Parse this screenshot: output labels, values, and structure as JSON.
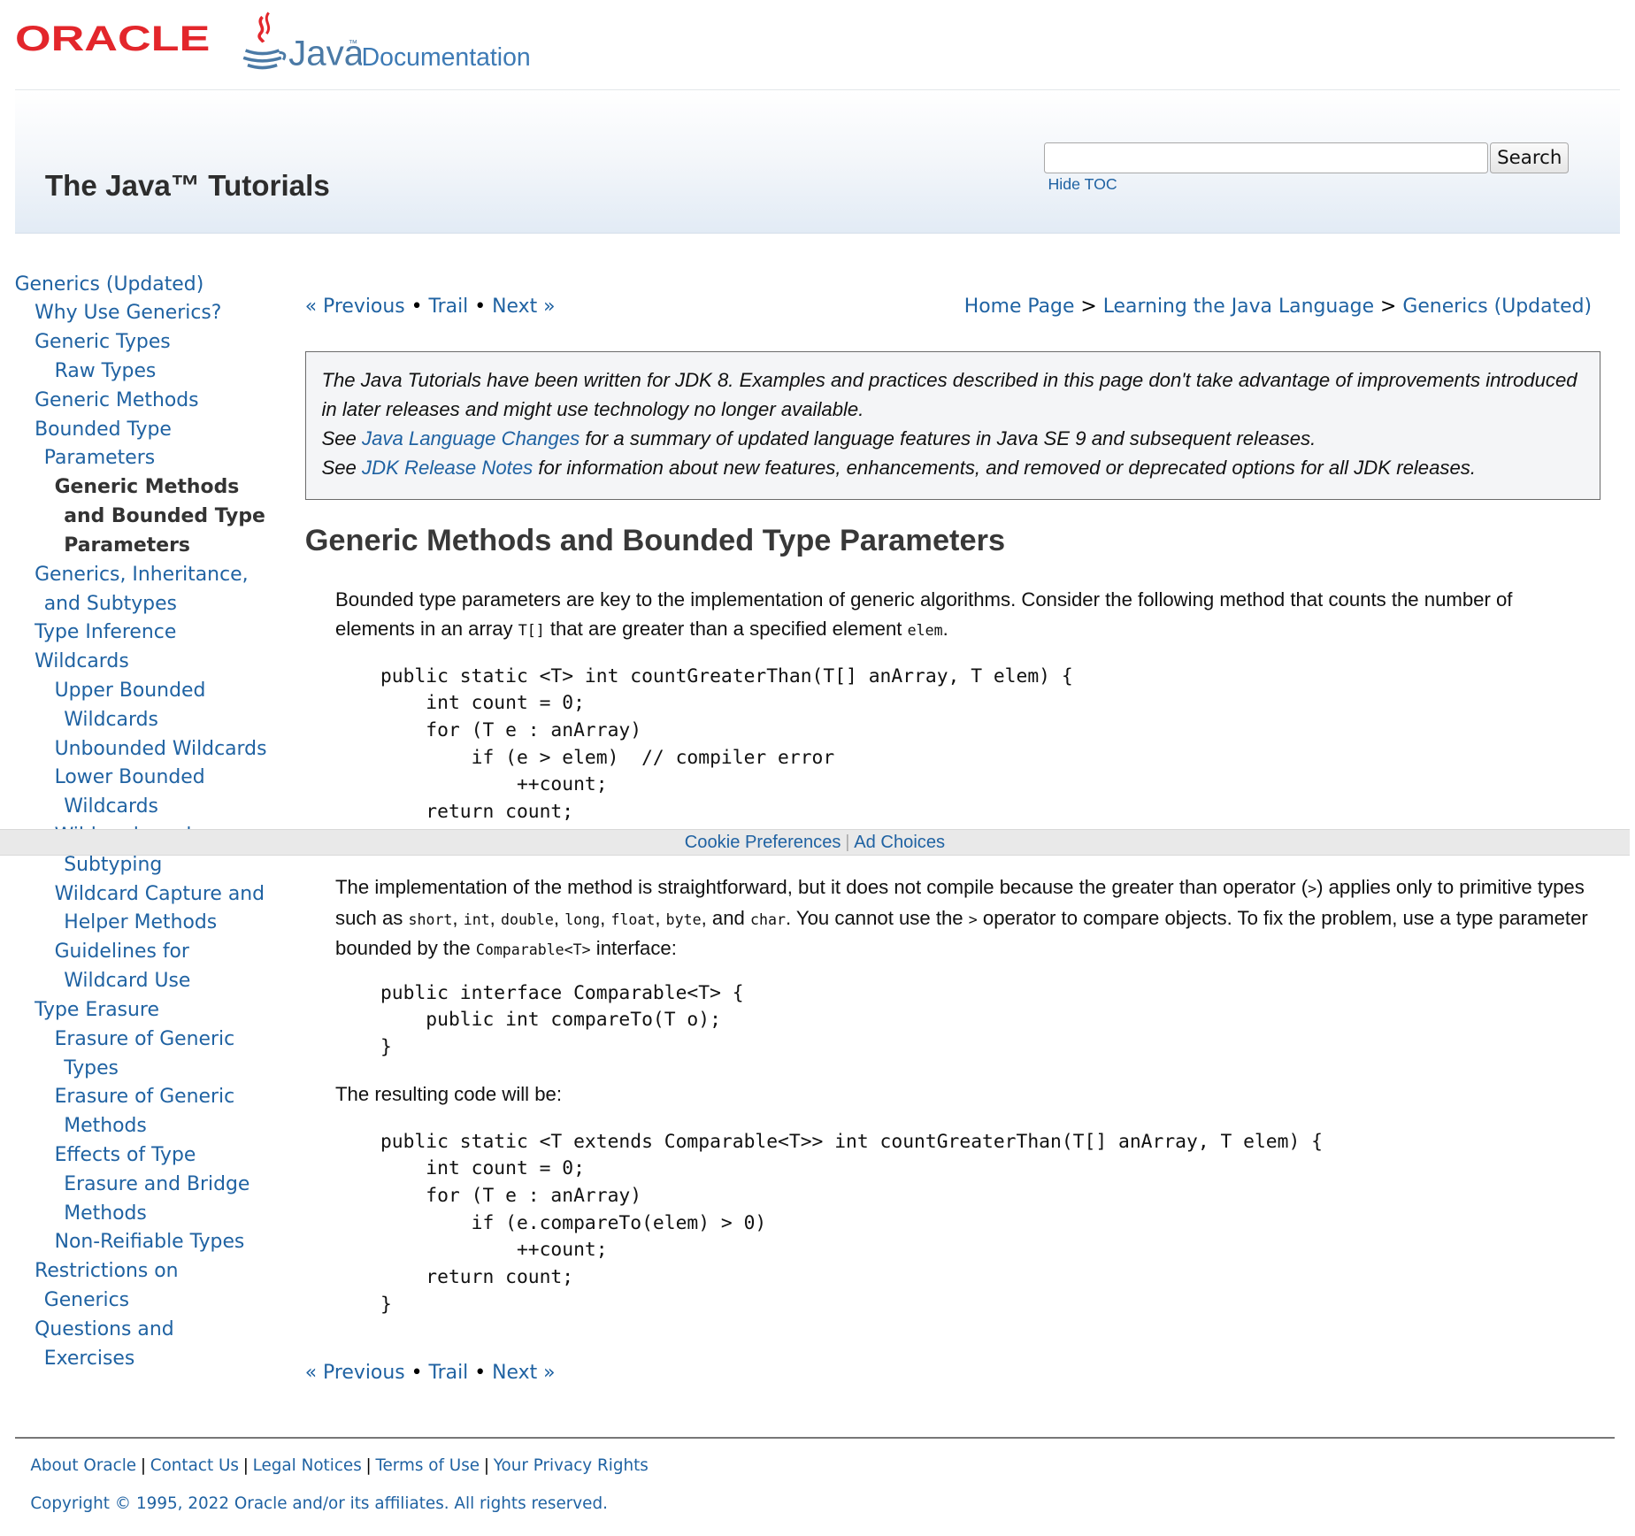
{
  "header": {
    "oracle_logo": "ORACLE",
    "java_logo": "Java",
    "documentation_link": "Documentation",
    "banner_title": "The Java™ Tutorials",
    "search_button": "Search",
    "search_placeholder": "",
    "hide_toc": "Hide TOC"
  },
  "sidebar": {
    "items": [
      {
        "label": "Generics (Updated)"
      },
      {
        "label": "Why Use Generics?"
      },
      {
        "label": "Generic Types"
      },
      {
        "label": "Raw Types"
      },
      {
        "label": "Generic Methods"
      },
      {
        "label": "Bounded Type Parameters"
      },
      {
        "label": "Generic Methods and Bounded Type Parameters"
      },
      {
        "label": "Generics, Inheritance, and Subtypes"
      },
      {
        "label": "Type Inference"
      },
      {
        "label": "Wildcards"
      },
      {
        "label": "Upper Bounded Wildcards"
      },
      {
        "label": "Unbounded Wildcards"
      },
      {
        "label": "Lower Bounded Wildcards"
      },
      {
        "label": "Wildcards and Subtyping"
      },
      {
        "label": "Wildcard Capture and Helper Methods"
      },
      {
        "label": "Guidelines for Wildcard Use"
      },
      {
        "label": "Type Erasure"
      },
      {
        "label": "Erasure of Generic Types"
      },
      {
        "label": "Erasure of Generic Methods"
      },
      {
        "label": "Effects of Type Erasure and Bridge Methods"
      },
      {
        "label": "Non-Reifiable Types"
      },
      {
        "label": "Restrictions on Generics"
      },
      {
        "label": "Questions and Exercises"
      }
    ]
  },
  "nav": {
    "previous": "« Previous",
    "trail": "Trail",
    "next": "Next »",
    "separator": "•"
  },
  "breadcrumb": {
    "home": "Home Page",
    "learning": "Learning the Java Language",
    "generics": "Generics (Updated)",
    "separator": ">"
  },
  "note": {
    "line1": "The Java Tutorials have been written for JDK 8. Examples and practices described in this page don't take advantage of improvements introduced in later releases and might use technology no longer available.",
    "see": "See",
    "link1": "Java Language Changes",
    "line2_rest": "for a summary of updated language features in Java SE 9 and subsequent releases.",
    "link2": "JDK Release Notes",
    "line3_rest": "for information about new features, enhancements, and removed or deprecated options for all JDK releases."
  },
  "content": {
    "title": "Generic Methods and Bounded Type Parameters",
    "p1_a": "Bounded type parameters are key to the implementation of generic algorithms. Consider the following method that counts the number of elements in an array",
    "p1_code1": "T[]",
    "p1_b": "that are greater than a specified element",
    "p1_code2": "elem",
    "p1_c": ".",
    "code1": "public static <T> int countGreaterThan(T[] anArray, T elem) {\n    int count = 0;\n    for (T e : anArray)\n        if (e > elem)  // compiler error\n            ++count;\n    return count;\n}",
    "p2_a": "The implementation of the method is straightforward, but it does not compile because the greater than operator (",
    "p2_gt": ">",
    "p2_b": ") applies only to primitive types such as",
    "types": [
      "short",
      "int",
      "double",
      "long",
      "float",
      "byte"
    ],
    "and": "and",
    "char": "char",
    "p2_c": ". You cannot use the",
    "p2_d": "operator to compare objects. To fix the problem, use a type parameter bounded by the",
    "comparable": "Comparable<T>",
    "p2_e": "interface:",
    "code2": "public interface Comparable<T> {\n    public int compareTo(T o);\n}",
    "p3": "The resulting code will be:",
    "code3": "public static <T extends Comparable<T>> int countGreaterThan(T[] anArray, T elem) {\n    int count = 0;\n    for (T e : anArray)\n        if (e.compareTo(elem) > 0)\n            ++count;\n    return count;\n}"
  },
  "cookie_bar": {
    "cookie_preferences": "Cookie Preferences",
    "separator": "|",
    "ad_choices": "Ad Choices"
  },
  "footer": {
    "links": [
      "About Oracle",
      "Contact Us",
      "Legal Notices",
      "Terms of Use",
      "Your Privacy Rights"
    ],
    "separator": "|",
    "copyright": "Copyright © 1995, 2022 Oracle and/or its affiliates. All rights reserved."
  },
  "colors": {
    "link": "#1f62a2",
    "oracle_red": "#e3262b",
    "java_blue": "#4b7aa6"
  }
}
